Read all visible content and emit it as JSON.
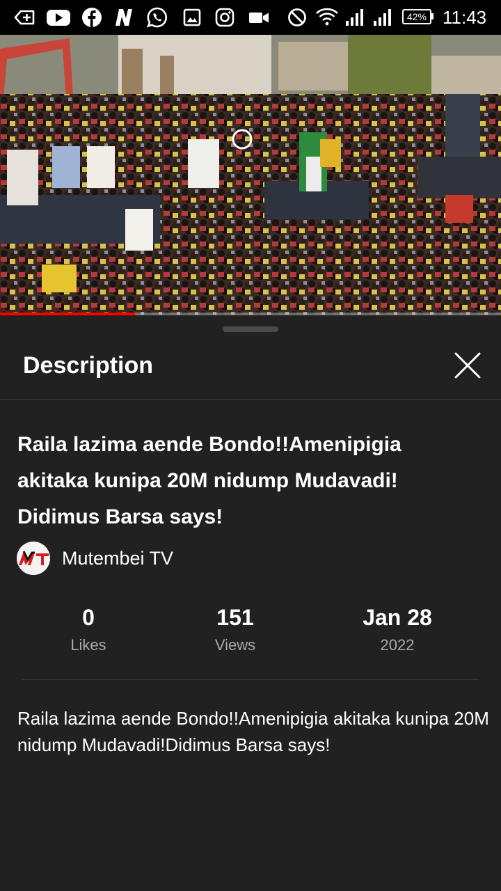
{
  "status_bar": {
    "icons": [
      "back-arrow-icon",
      "youtube-icon",
      "facebook-icon",
      "netflix-icon",
      "whatsapp-icon",
      "gallery-icon",
      "instagram-icon",
      "video-camera-icon",
      "do-not-disturb-icon",
      "wifi-icon",
      "cell-signal-1-icon",
      "cell-signal-2-icon"
    ],
    "battery": "42%",
    "time": "11:43"
  },
  "video": {
    "progress": 0.27,
    "accent_color": "#ff0000"
  },
  "sheet": {
    "title": "Description",
    "video_title": "Raila lazima aende Bondo!!Amenipigia akitaka kunipa 20M nidump Mudavadi! Didimus Barsa says!",
    "channel": {
      "name": "Mutembei TV",
      "avatar_icon": "channel-logo-icon"
    },
    "stats": [
      {
        "value": "0",
        "label": "Likes"
      },
      {
        "value": "151",
        "label": "Views"
      },
      {
        "value": "Jan 28",
        "label": "2022"
      }
    ],
    "description": "Raila lazima aende Bondo!!Amenipigia akitaka kunipa 20M nidump Mudavadi!Didimus Barsa says!"
  }
}
